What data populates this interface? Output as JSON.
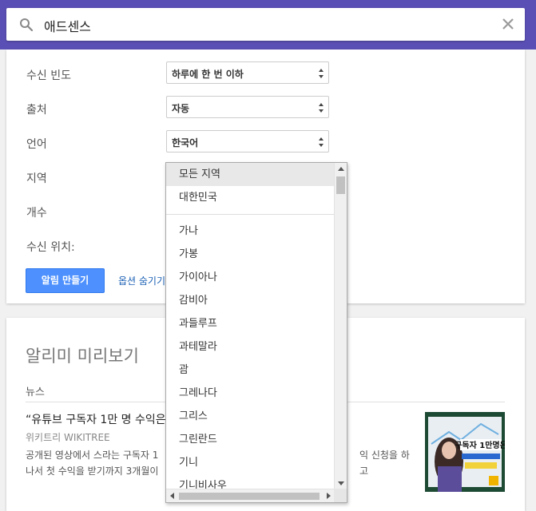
{
  "search": {
    "query": "애드센스"
  },
  "options": {
    "frequency": {
      "label": "수신 빈도",
      "value": "하루에 한 번 이하"
    },
    "source": {
      "label": "출처",
      "value": "자동"
    },
    "language": {
      "label": "언어",
      "value": "한국어"
    },
    "region": {
      "label": "지역"
    },
    "count": {
      "label": "개수"
    },
    "deliver_to": {
      "label": "수신 위치:"
    },
    "create_button": "알림 만들기",
    "hide_options": "옵션 숨기기"
  },
  "preview": {
    "title": "알리미 미리보기",
    "section": "뉴스",
    "news": {
      "title": "“유튜브 구독자 1만 명 수익은",
      "source": "위키트리 WIKITREE",
      "snippet_line1": "공개된 영상에서 스라는 구독자 1",
      "snippet_line1_end": "익 신청을 하고",
      "snippet_line2": "나서 첫 수익을 받기까지 3개월이"
    },
    "thumbnail_text": "구독자 1만명은"
  },
  "region_dropdown": {
    "top_items": [
      "모든 지역",
      "대한민국"
    ],
    "items": [
      "가나",
      "가봉",
      "가이아나",
      "감비아",
      "과들루프",
      "과테말라",
      "괌",
      "그레나다",
      "그리스",
      "그린란드",
      "기니",
      "기니비사우"
    ]
  },
  "colors": {
    "header": "#5a4fb4",
    "primary_button": "#4d90fe",
    "link": "#1a5fb4"
  }
}
